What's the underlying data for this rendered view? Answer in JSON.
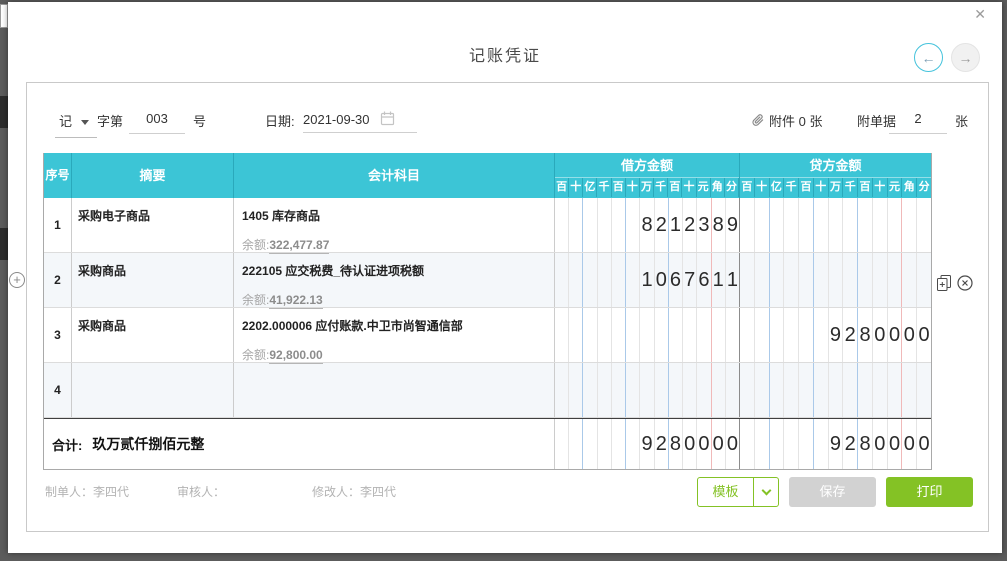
{
  "title": "记账凭证",
  "voucher_header": {
    "type_value": "记",
    "word_label": "字第",
    "number_value": "003",
    "number_suffix": "号",
    "date_label": "日期:",
    "date_value": "2021-09-30",
    "attachment_label": "附件 0 张",
    "receipts_label": "附单据",
    "receipts_value": "2",
    "receipts_unit": "张"
  },
  "nav": {
    "prev": "←",
    "next": "→",
    "close": "✕"
  },
  "table": {
    "headers": {
      "seq": "序号",
      "summary": "摘要",
      "account": "会计科目",
      "debit": "借方金额",
      "credit": "贷方金额"
    },
    "digit_labels": [
      "百",
      "十",
      "亿",
      "千",
      "百",
      "十",
      "万",
      "千",
      "百",
      "十",
      "元",
      "角",
      "分"
    ],
    "rows": [
      {
        "seq": "1",
        "summary": "采购电子商品",
        "account": "1405 库存商品",
        "balance_label": "余额:",
        "balance": "322,477.87",
        "debit": [
          "",
          "",
          "",
          "",
          "",
          "",
          "8",
          "2",
          "1",
          "2",
          "3",
          "8",
          "9"
        ],
        "credit": [
          "",
          "",
          "",
          "",
          "",
          "",
          "",
          "",
          "",
          "",
          "",
          "",
          ""
        ]
      },
      {
        "seq": "2",
        "summary": "采购商品",
        "account": "222105 应交税费_待认证进项税额",
        "balance_label": "余额:",
        "balance": "41,922.13",
        "debit": [
          "",
          "",
          "",
          "",
          "",
          "",
          "1",
          "0",
          "6",
          "7",
          "6",
          "1",
          "1"
        ],
        "credit": [
          "",
          "",
          "",
          "",
          "",
          "",
          "",
          "",
          "",
          "",
          "",
          "",
          ""
        ]
      },
      {
        "seq": "3",
        "summary": "采购商品",
        "account": "2202.000006 应付账款.中卫市尚智通信部",
        "balance_label": "余额:",
        "balance": "92,800.00",
        "debit": [
          "",
          "",
          "",
          "",
          "",
          "",
          "",
          "",
          "",
          "",
          "",
          "",
          ""
        ],
        "credit": [
          "",
          "",
          "",
          "",
          "",
          "",
          "9",
          "2",
          "8",
          "0",
          "0",
          "0",
          "0"
        ]
      },
      {
        "seq": "4",
        "summary": "",
        "account": "",
        "balance_label": "",
        "balance": "",
        "debit": [
          "",
          "",
          "",
          "",
          "",
          "",
          "",
          "",
          "",
          "",
          "",
          "",
          ""
        ],
        "credit": [
          "",
          "",
          "",
          "",
          "",
          "",
          "",
          "",
          "",
          "",
          "",
          "",
          ""
        ]
      }
    ],
    "total": {
      "label": "合计:",
      "words": "玖万贰仟捌佰元整",
      "debit": [
        "",
        "",
        "",
        "",
        "",
        "",
        "9",
        "2",
        "8",
        "0",
        "0",
        "0",
        "0"
      ],
      "credit": [
        "",
        "",
        "",
        "",
        "",
        "",
        "9",
        "2",
        "8",
        "0",
        "0",
        "0",
        "0"
      ]
    }
  },
  "footer": {
    "maker_label": "制单人：",
    "maker": "李四代",
    "auditor_label": "审核人：",
    "auditor": "",
    "modifier_label": "修改人：",
    "modifier": "李四代",
    "buttons": {
      "template": "模板",
      "save": "保存",
      "print": "打印"
    }
  },
  "colors": {
    "teal": "#3cc5d6",
    "green": "#84c225"
  }
}
